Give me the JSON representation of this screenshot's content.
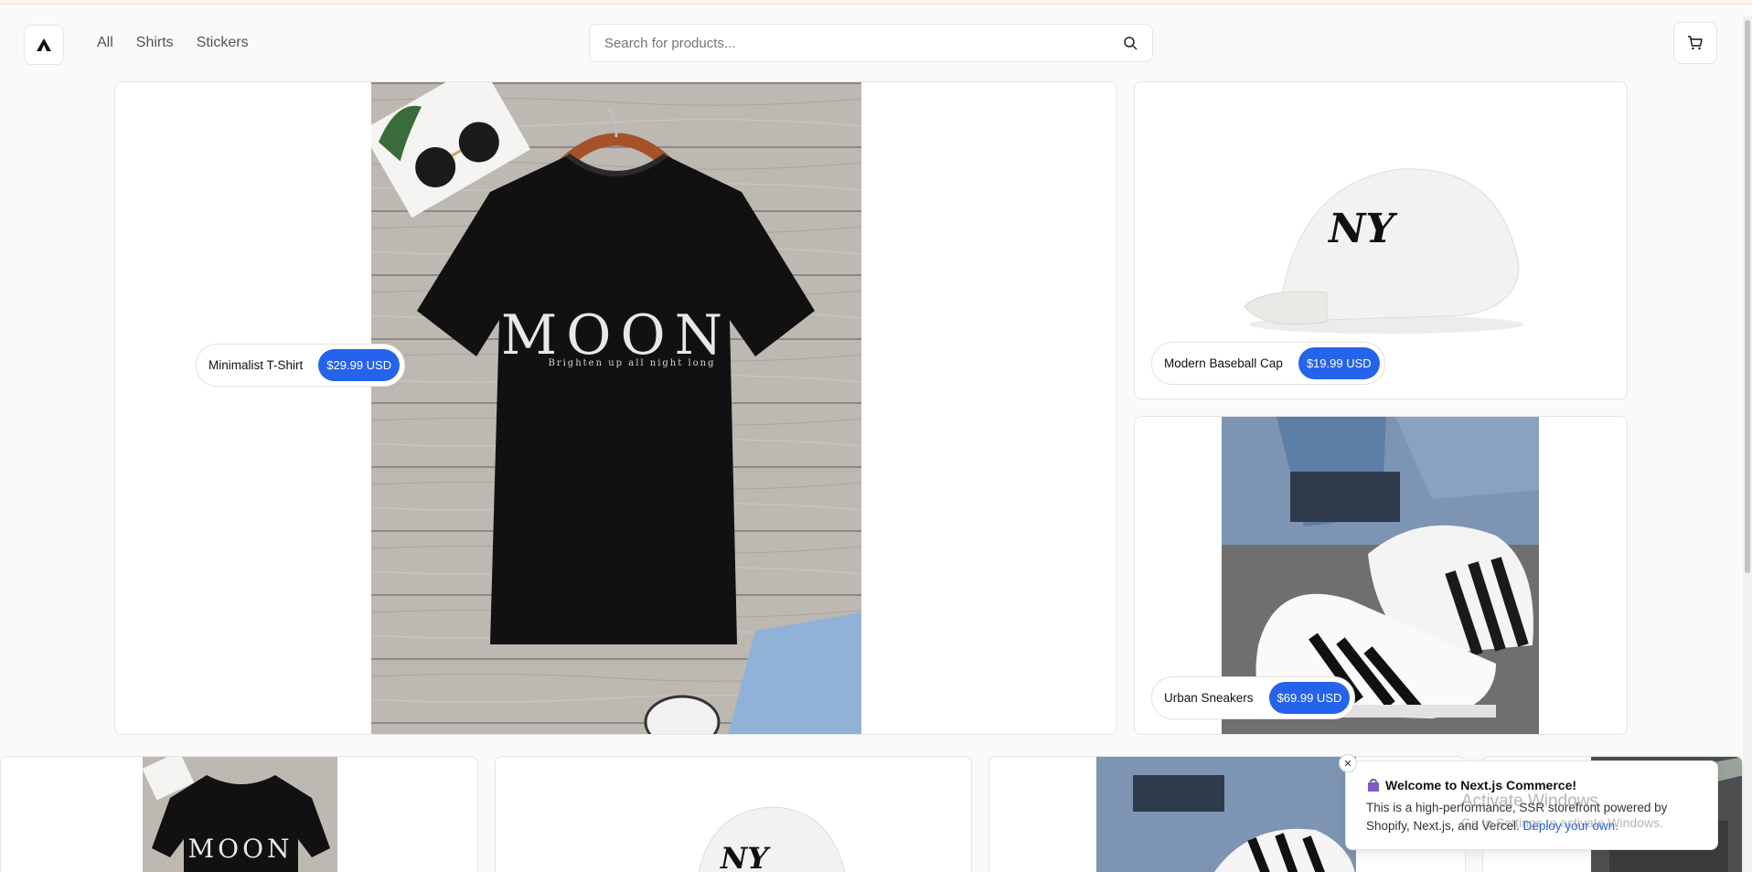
{
  "header": {
    "nav": [
      "All",
      "Shirts",
      "Stickers"
    ],
    "search_placeholder": "Search for products..."
  },
  "products": {
    "main": {
      "name": "Minimalist T-Shirt",
      "price": "$29.99 USD",
      "print_title": "MOON",
      "print_subtitle": "Brighten up all night long"
    },
    "cap": {
      "name": "Modern Baseball Cap",
      "price": "$19.99 USD",
      "logo": "NY"
    },
    "shoe": {
      "name": "Urban Sneakers",
      "price": "$69.99 USD"
    }
  },
  "toast": {
    "title": "Welcome to Next.js Commerce!",
    "body": "This is a high-performance, SSR storefront powered by Shopify, Next.js, and Vercel.",
    "link": "Deploy your own."
  },
  "watermark": {
    "line1": "Activate Windows",
    "line2": "Go to Settings to activate Windows."
  },
  "colors": {
    "accent": "#2563eb",
    "shirt": "#111111",
    "wood": "#b9b4ad"
  },
  "icons": [
    "logo-icon",
    "search-icon",
    "cart-icon",
    "close-icon",
    "shopping-bag-icon"
  ]
}
